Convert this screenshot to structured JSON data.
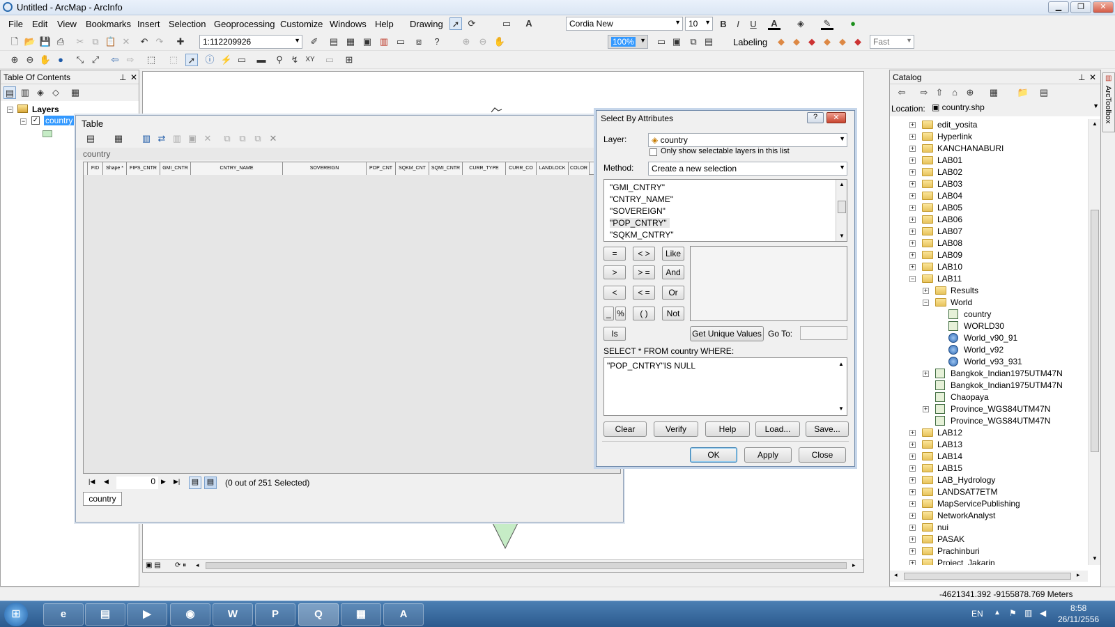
{
  "window": {
    "title": "Untitled - ArcMap - ArcInfo",
    "minimize": "▁",
    "restore": "❐",
    "close": "✕"
  },
  "menu": [
    "File",
    "Edit",
    "View",
    "Bookmarks",
    "Insert",
    "Selection",
    "Geoprocessing",
    "Customize",
    "Windows",
    "Help"
  ],
  "toolbar": {
    "scale": "1:112209926",
    "drawing_label": "Drawing",
    "font_name": "Cordia New",
    "font_size": "10",
    "zoom_value": "100%",
    "labeling_label": "Labeling",
    "quality": "Fast",
    "bold": "B",
    "italic": "I",
    "underline": "U"
  },
  "toc": {
    "title": "Table Of Contents",
    "root": "Layers",
    "layer": "country"
  },
  "table": {
    "title": "Table",
    "layer_name": "country",
    "columns": [
      "FID",
      "Shape *",
      "FIPS_CNTR",
      "GMI_CNTR",
      "CNTRY_NAME",
      "SOVEREIGN",
      "POP_CNT",
      "SQKM_CNT",
      "SQMI_CNTR",
      "CURR_TYPE",
      "CURR_CO",
      "LANDLOCK",
      "COLOR"
    ],
    "record": "0",
    "selected_text": "(0 out of 251 Selected)",
    "tab": "country"
  },
  "dialog": {
    "title": "Select By Attributes",
    "help_btn": "?",
    "close_btn": "✕",
    "layer_label": "Layer:",
    "layer_value": "country",
    "only_selectable": "Only show selectable layers in this list",
    "method_label": "Method:",
    "method_value": "Create a new selection",
    "fields": [
      "\"GMI_CNTRY\"",
      "\"CNTRY_NAME\"",
      "\"SOVEREIGN\"",
      "\"POP_CNTRY\"",
      "\"SQKM_CNTRY\""
    ],
    "ops": {
      "eq": "=",
      "ne": "< >",
      "like": "Like",
      "gt": ">",
      "ge": "> =",
      "and": "And",
      "lt": "<",
      "le": "< =",
      "or": "Or",
      "us": "_",
      "pct": "%",
      "paren": "( )",
      "not": "Not",
      "is": "Is"
    },
    "get_unique": "Get Unique Values",
    "goto_label": "Go To:",
    "sql_label": "SELECT * FROM country WHERE:",
    "sql_text": "\"POP_CNTRY\"IS NULL",
    "buttons": {
      "clear": "Clear",
      "verify": "Verify",
      "help": "Help",
      "load": "Load...",
      "save": "Save...",
      "ok": "OK",
      "apply": "Apply",
      "close": "Close"
    }
  },
  "catalog": {
    "title": "Catalog",
    "location_label": "Location:",
    "location_value": "country.shp",
    "items": [
      {
        "label": "edit_yosita",
        "indent": 0,
        "type": "folder",
        "exp": "+"
      },
      {
        "label": "Hyperlink",
        "indent": 0,
        "type": "folder",
        "exp": "+"
      },
      {
        "label": "KANCHANABURI",
        "indent": 0,
        "type": "folder",
        "exp": "+"
      },
      {
        "label": "LAB01",
        "indent": 0,
        "type": "folder",
        "exp": "+"
      },
      {
        "label": "LAB02",
        "indent": 0,
        "type": "folder",
        "exp": "+"
      },
      {
        "label": "LAB03",
        "indent": 0,
        "type": "folder",
        "exp": "+"
      },
      {
        "label": "LAB04",
        "indent": 0,
        "type": "folder",
        "exp": "+"
      },
      {
        "label": "LAB05",
        "indent": 0,
        "type": "folder",
        "exp": "+"
      },
      {
        "label": "LAB06",
        "indent": 0,
        "type": "folder",
        "exp": "+"
      },
      {
        "label": "LAB07",
        "indent": 0,
        "type": "folder",
        "exp": "+"
      },
      {
        "label": "LAB08",
        "indent": 0,
        "type": "folder",
        "exp": "+"
      },
      {
        "label": "LAB09",
        "indent": 0,
        "type": "folder",
        "exp": "+"
      },
      {
        "label": "LAB10",
        "indent": 0,
        "type": "folder",
        "exp": "+"
      },
      {
        "label": "LAB11",
        "indent": 0,
        "type": "folder",
        "exp": "−"
      },
      {
        "label": "Results",
        "indent": 1,
        "type": "folder",
        "exp": "+"
      },
      {
        "label": "World",
        "indent": 1,
        "type": "folder",
        "exp": "−"
      },
      {
        "label": "country",
        "indent": 2,
        "type": "layer",
        "exp": ""
      },
      {
        "label": "WORLD30",
        "indent": 2,
        "type": "layer",
        "exp": ""
      },
      {
        "label": "World_v90_91",
        "indent": 2,
        "type": "globe",
        "exp": ""
      },
      {
        "label": "World_v92",
        "indent": 2,
        "type": "globe",
        "exp": ""
      },
      {
        "label": "World_v93_931",
        "indent": 2,
        "type": "globe",
        "exp": ""
      },
      {
        "label": "Bangkok_Indian1975UTM47N",
        "indent": 1,
        "type": "layer",
        "exp": "+"
      },
      {
        "label": "Bangkok_Indian1975UTM47N",
        "indent": 1,
        "type": "layer",
        "exp": ""
      },
      {
        "label": "Chaopaya",
        "indent": 1,
        "type": "layer",
        "exp": ""
      },
      {
        "label": "Province_WGS84UTM47N",
        "indent": 1,
        "type": "layer",
        "exp": "+"
      },
      {
        "label": "Province_WGS84UTM47N",
        "indent": 1,
        "type": "layer",
        "exp": ""
      },
      {
        "label": "LAB12",
        "indent": 0,
        "type": "folder",
        "exp": "+"
      },
      {
        "label": "LAB13",
        "indent": 0,
        "type": "folder",
        "exp": "+"
      },
      {
        "label": "LAB14",
        "indent": 0,
        "type": "folder",
        "exp": "+"
      },
      {
        "label": "LAB15",
        "indent": 0,
        "type": "folder",
        "exp": "+"
      },
      {
        "label": "LAB_Hydrology",
        "indent": 0,
        "type": "folder",
        "exp": "+"
      },
      {
        "label": "LANDSAT7ETM",
        "indent": 0,
        "type": "folder",
        "exp": "+"
      },
      {
        "label": "MapServicePublishing",
        "indent": 0,
        "type": "folder",
        "exp": "+"
      },
      {
        "label": "NetworkAnalyst",
        "indent": 0,
        "type": "folder",
        "exp": "+"
      },
      {
        "label": "nui",
        "indent": 0,
        "type": "folder",
        "exp": "+"
      },
      {
        "label": "PASAK",
        "indent": 0,
        "type": "folder",
        "exp": "+"
      },
      {
        "label": "Prachinburi",
        "indent": 0,
        "type": "folder",
        "exp": "+"
      },
      {
        "label": "Project_Jakarin",
        "indent": 0,
        "type": "folder",
        "exp": "+"
      }
    ]
  },
  "arctoolbox": "ArcToolbox",
  "status": {
    "coords": "-4621341.392  -9155878.769 Meters"
  },
  "taskbar": {
    "start": "⊞",
    "apps": [
      "e",
      "▤",
      "▶",
      "◉",
      "W",
      "P",
      "Q",
      "▦",
      "A"
    ],
    "lang": "EN",
    "time": "8:58",
    "date": "26/11/2556"
  },
  "colors": {
    "dialog_border": "#6d87a8",
    "selection": "#3399ff",
    "map_symbol": "#c6ecc6"
  }
}
